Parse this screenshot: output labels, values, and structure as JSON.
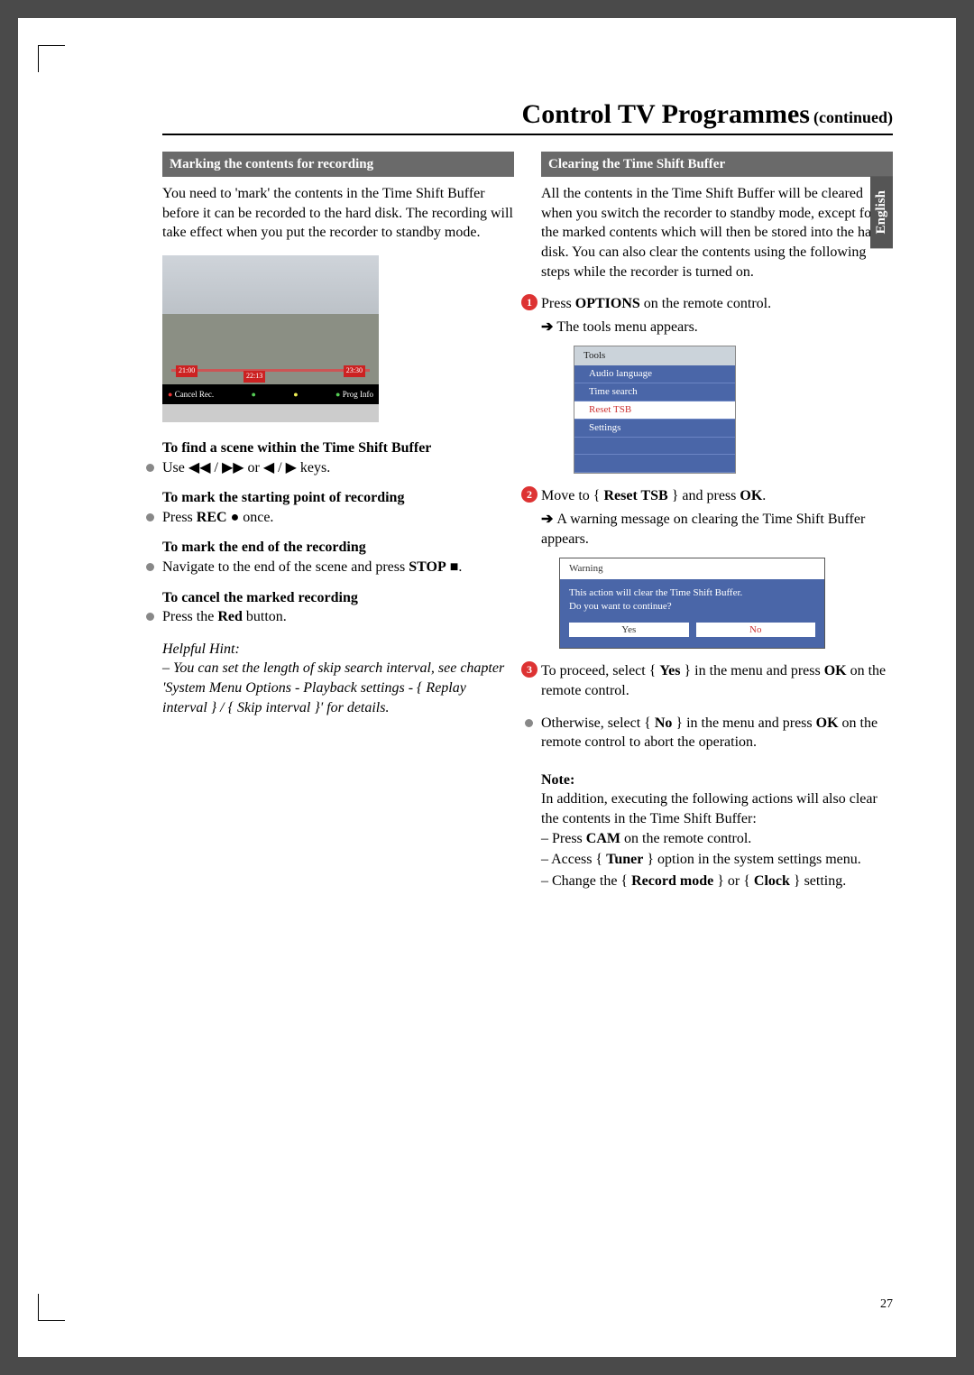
{
  "title": {
    "main": "Control TV Programmes",
    "cont": "(continued)"
  },
  "sideTab": "English",
  "pageNo": "27",
  "left": {
    "sectionBar": "Marking the contents for recording",
    "intro": "You need to 'mark' the contents in the Time Shift Buffer before it can be recorded to the hard disk. The recording will take effect when you put the recorder to standby mode.",
    "img": {
      "t1": "21:00",
      "t2": "23:30",
      "tc": "22:13",
      "barCancel": "Cancel Rec.",
      "barProg": "Prog Info"
    },
    "h1": "To find a scene within the Time Shift Buffer",
    "b1": "Use ◀◀ / ▶▶ or ◀ / ▶ keys.",
    "h2": "To mark the starting point of recording",
    "b2_pre": "Press ",
    "b2_bold": "REC",
    "b2_post": " ● once.",
    "h3": "To mark the end of the recording",
    "b3_pre": "Navigate to the end of the scene and press ",
    "b3_bold": "STOP",
    "b3_post": " ■.",
    "h4": "To cancel the marked recording",
    "b4_pre": "Press the ",
    "b4_bold": "Red",
    "b4_post": " button.",
    "hintTitle": "Helpful Hint:",
    "hintBody": "– You can set the length of skip search interval, see chapter 'System Menu Options - Playback settings - { Replay interval } / { Skip interval }' for details."
  },
  "right": {
    "sectionBar": "Clearing the Time Shift Buffer",
    "intro": "All the contents in the Time Shift Buffer will be cleared when you switch the recorder to standby mode, except for the marked contents which will then be stored into the hard disk. You can also clear the contents using the following steps while the recorder is turned on.",
    "s1_pre": "Press ",
    "s1_bold": "OPTIONS",
    "s1_post": " on the remote control.",
    "s1_result": "The tools menu appears.",
    "tools": {
      "title": "Tools",
      "items": [
        "Audio language",
        "Time search",
        "Reset TSB",
        "Settings"
      ]
    },
    "s2_pre": "Move to { ",
    "s2_bold1": "Reset TSB",
    "s2_mid": " } and press ",
    "s2_bold2": "OK",
    "s2_post": ".",
    "s2_result": "A warning message on clearing the Time Shift Buffer appears.",
    "warn": {
      "title": "Warning",
      "line1": "This action will clear the Time Shift Buffer.",
      "line2": "Do you want to continue?",
      "yes": "Yes",
      "no": "No"
    },
    "s3_pre": "To proceed, select { ",
    "s3_bold1": "Yes",
    "s3_mid": " } in the menu and press ",
    "s3_bold2": "OK",
    "s3_post": " on the remote control.",
    "s4_pre": "Otherwise, select { ",
    "s4_bold1": "No",
    "s4_mid": " } in the menu and press ",
    "s4_bold2": "OK",
    "s4_post": " on the remote control to abort the operation.",
    "noteTitle": "Note:",
    "noteIntro": "In addition, executing the following actions will also clear the contents in the Time Shift Buffer:",
    "n1_pre": "–  Press ",
    "n1_bold": "CAM",
    "n1_post": " on the remote control.",
    "n2_pre": "–  Access { ",
    "n2_bold": "Tuner",
    "n2_post": " } option in the system settings menu.",
    "n3_pre": "–  Change the { ",
    "n3_bold": "Record mode",
    "n3_mid": " } or { ",
    "n3_bold2": "Clock",
    "n3_post": " } setting."
  }
}
